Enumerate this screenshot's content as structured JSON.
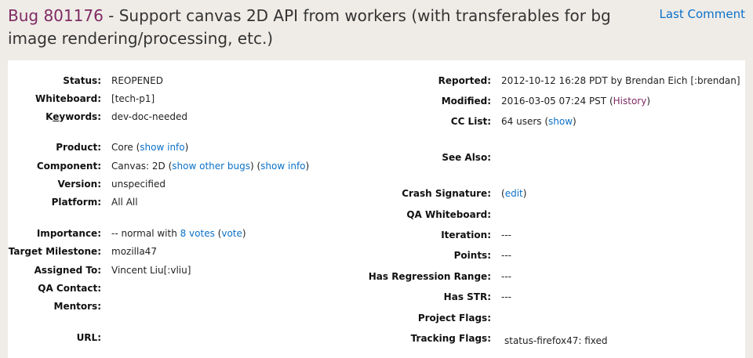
{
  "header": {
    "bug_id": "Bug 801176",
    "title": " - Support canvas 2D API from workers (with transferables for bg image rendering/processing, etc.)",
    "last_comment": "Last Comment"
  },
  "left": {
    "status": {
      "label": "Status:",
      "value": "REOPENED"
    },
    "whiteboard": {
      "label": "Whiteboard:",
      "value": "[tech-p1]"
    },
    "keywords": {
      "label_pre": "K",
      "label_ul": "e",
      "label_post": "ywords:",
      "value": "dev-doc-needed"
    },
    "product": {
      "label": "Product:",
      "value": "Core ",
      "show_info": "show info"
    },
    "component": {
      "label": "Component:",
      "value": "Canvas: 2D ",
      "show_other_bugs": "show other bugs",
      "show_info": "show info"
    },
    "version": {
      "label": "Version:",
      "value": "unspecified"
    },
    "platform": {
      "label": "Platform:",
      "value": "All All"
    },
    "importance": {
      "label": "Importance:",
      "value": "-- normal with ",
      "votes": "8 votes",
      "vote": "vote"
    },
    "target_milestone": {
      "label": "Target Milestone:",
      "value": "mozilla47"
    },
    "assigned_to": {
      "label": "Assigned To:",
      "value": "Vincent Liu[:vliu]"
    },
    "qa_contact": {
      "label": "QA Contact:",
      "value": ""
    },
    "mentors": {
      "label": "Mentors:",
      "value": ""
    },
    "url": {
      "label": "URL:",
      "value": ""
    }
  },
  "right": {
    "reported": {
      "label": "Reported:",
      "value": "2012-10-12 16:28 PDT by Brendan Eich [:brendan]"
    },
    "modified": {
      "label": "Modified:",
      "value": "2016-03-05 07:24 PST (",
      "history": "History",
      "close": ")"
    },
    "cc_list": {
      "label": "CC List:",
      "value": "64 users (",
      "show": "show",
      "close": ")"
    },
    "see_also": {
      "label": "See Also:",
      "value": ""
    },
    "crash_signature": {
      "label": "Crash Signature:",
      "value": "(",
      "edit": "edit",
      "close": ")"
    },
    "qa_whiteboard": {
      "label": "QA Whiteboard:",
      "value": ""
    },
    "iteration": {
      "label": "Iteration:",
      "value": "---"
    },
    "points": {
      "label": "Points:",
      "value": "---"
    },
    "has_regression_range": {
      "label": "Has Regression Range:",
      "value": "---"
    },
    "has_str": {
      "label": "Has STR:",
      "value": "---"
    },
    "project_flags": {
      "label": "Project Flags:",
      "value": ""
    },
    "tracking_flags": {
      "label": "Tracking Flags:",
      "value": "status-firefox47: fixed"
    }
  }
}
